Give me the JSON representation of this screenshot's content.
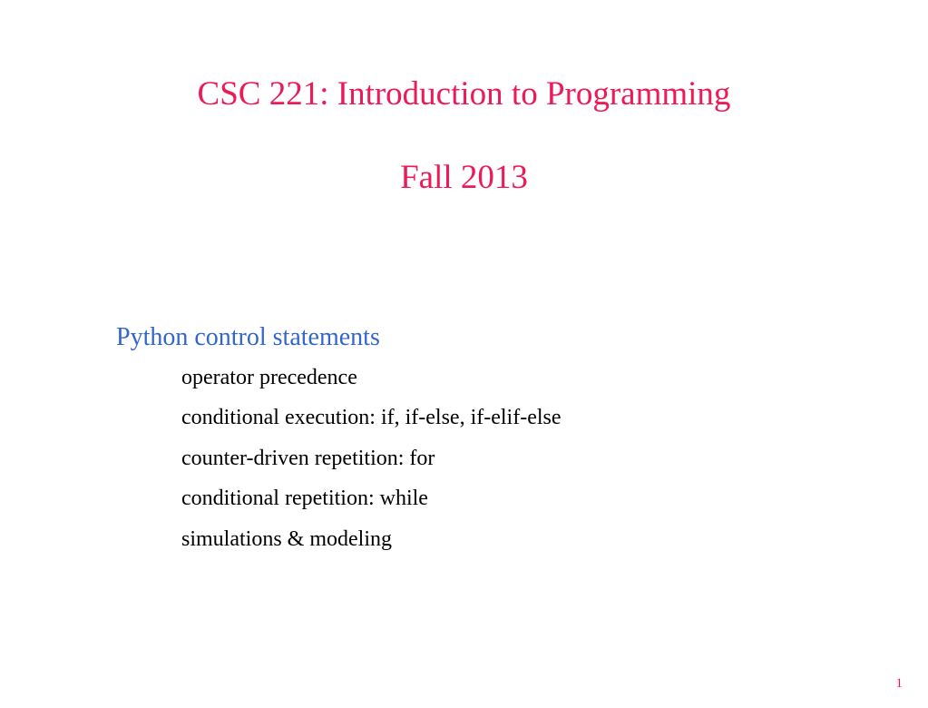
{
  "title": {
    "line1": "CSC 221: Introduction to Programming",
    "line2": "Fall 2013"
  },
  "content": {
    "subtitle": "Python control statements",
    "bullets": [
      "operator precedence",
      "conditional execution: if, if-else, if-elif-else",
      "counter-driven repetition: for",
      "conditional repetition: while",
      "simulations & modeling"
    ]
  },
  "bullet_glyph": "",
  "page_number": "1"
}
